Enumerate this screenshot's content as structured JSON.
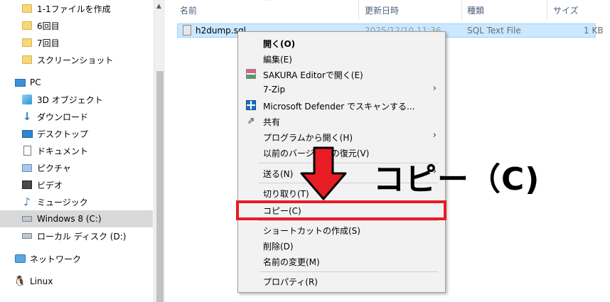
{
  "nav": {
    "items": [
      {
        "label": "1-1ファイルを作成",
        "icon": "folder-icon"
      },
      {
        "label": "6回目",
        "icon": "folder-icon"
      },
      {
        "label": "7回目",
        "icon": "folder-icon"
      },
      {
        "label": "スクリーンショット",
        "icon": "folder-icon"
      },
      {
        "label": "PC",
        "icon": "pc-icon"
      },
      {
        "label": "3D オブジェクト",
        "icon": "3d-objects-icon"
      },
      {
        "label": "ダウンロード",
        "icon": "download-icon"
      },
      {
        "label": "デスクトップ",
        "icon": "desktop-icon"
      },
      {
        "label": "ドキュメント",
        "icon": "documents-icon"
      },
      {
        "label": "ピクチャ",
        "icon": "pictures-icon"
      },
      {
        "label": "ビデオ",
        "icon": "videos-icon"
      },
      {
        "label": "ミュージック",
        "icon": "music-icon"
      },
      {
        "label": "Windows 8 (C:)",
        "icon": "system-drive-icon"
      },
      {
        "label": "ローカル ディスク (D:)",
        "icon": "drive-icon"
      },
      {
        "label": "ネットワーク",
        "icon": "network-icon"
      },
      {
        "label": "Linux",
        "icon": "linux-icon"
      }
    ]
  },
  "filelist": {
    "headers": {
      "name": "名前",
      "date": "更新日時",
      "type": "種類",
      "size": "サイズ"
    },
    "rows": [
      {
        "name": "h2dump.sql",
        "date": "2025/12/10 11:36",
        "type": "SQL Text File",
        "size": "1 KB"
      }
    ]
  },
  "context_menu": {
    "items": [
      {
        "label": "開く(O)",
        "bold": true
      },
      {
        "label": "編集(E)"
      },
      {
        "label": "SAKURA Editorで開く(E)",
        "icon": "sakura-editor-icon"
      },
      {
        "label": "7-Zip",
        "submenu": true
      },
      {
        "label": "Microsoft Defender でスキャンする...",
        "icon": "defender-icon"
      },
      {
        "label": "共有",
        "icon": "share-icon"
      },
      {
        "label": "プログラムから開く(H)",
        "submenu": true
      },
      {
        "label": "以前のバージョンの復元(V)"
      },
      {
        "label": "送る(N)",
        "submenu": true
      },
      {
        "label": "切り取り(T)"
      },
      {
        "label": "コピー(C)"
      },
      {
        "label": "ショートカットの作成(S)"
      },
      {
        "label": "削除(D)"
      },
      {
        "label": "名前の変更(M)"
      },
      {
        "label": "プロパティ(R)"
      }
    ],
    "submenu_glyph": "›"
  },
  "annotation": {
    "text": "コピー（C)",
    "highlight_color": "#e81c25",
    "arrow_color": "#e81c25"
  },
  "colors": {
    "selection": "#cce8ff",
    "selection_border": "#99d1ff",
    "nav_selected": "#d9d9d9",
    "header_text": "#4c607a"
  }
}
